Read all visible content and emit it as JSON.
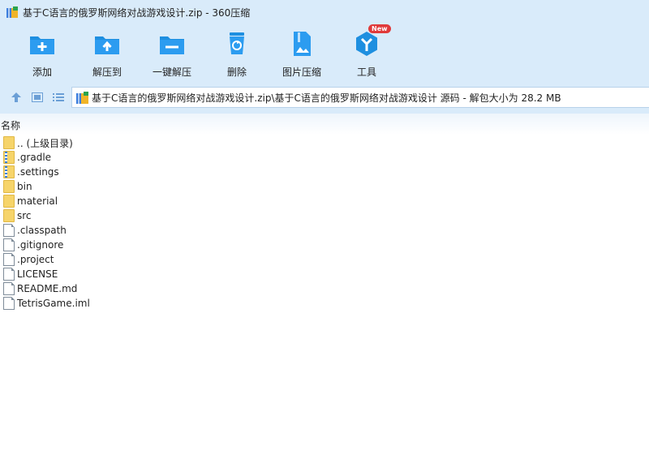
{
  "window": {
    "title": "基于C语言的俄罗斯网络对战游戏设计.zip - 360压缩"
  },
  "toolbar": {
    "items": [
      {
        "label": "添加"
      },
      {
        "label": "解压到"
      },
      {
        "label": "一键解压"
      },
      {
        "label": "删除"
      },
      {
        "label": "图片压缩"
      },
      {
        "label": "工具"
      }
    ],
    "badge": "New"
  },
  "address": {
    "path": "基于C语言的俄罗斯网络对战游戏设计.zip\\基于C语言的俄罗斯网络对战游戏设计 源码 - 解包大小为 28.2 MB"
  },
  "list": {
    "column_name": "名称",
    "items": [
      {
        "name": ".. (上级目录)",
        "type": "folder"
      },
      {
        "name": ".gradle",
        "type": "folder-zip"
      },
      {
        "name": ".settings",
        "type": "folder-zip"
      },
      {
        "name": "bin",
        "type": "folder"
      },
      {
        "name": "material",
        "type": "folder"
      },
      {
        "name": "src",
        "type": "folder"
      },
      {
        "name": ".classpath",
        "type": "file"
      },
      {
        "name": ".gitignore",
        "type": "file"
      },
      {
        "name": ".project",
        "type": "file"
      },
      {
        "name": "LICENSE",
        "type": "file"
      },
      {
        "name": "README.md",
        "type": "file"
      },
      {
        "name": "TetrisGame.iml",
        "type": "file"
      }
    ]
  },
  "colors": {
    "toolbar_bg": "#d9ebfa",
    "icon_blue": "#1e8fe0",
    "badge_red": "#e03a3a"
  }
}
